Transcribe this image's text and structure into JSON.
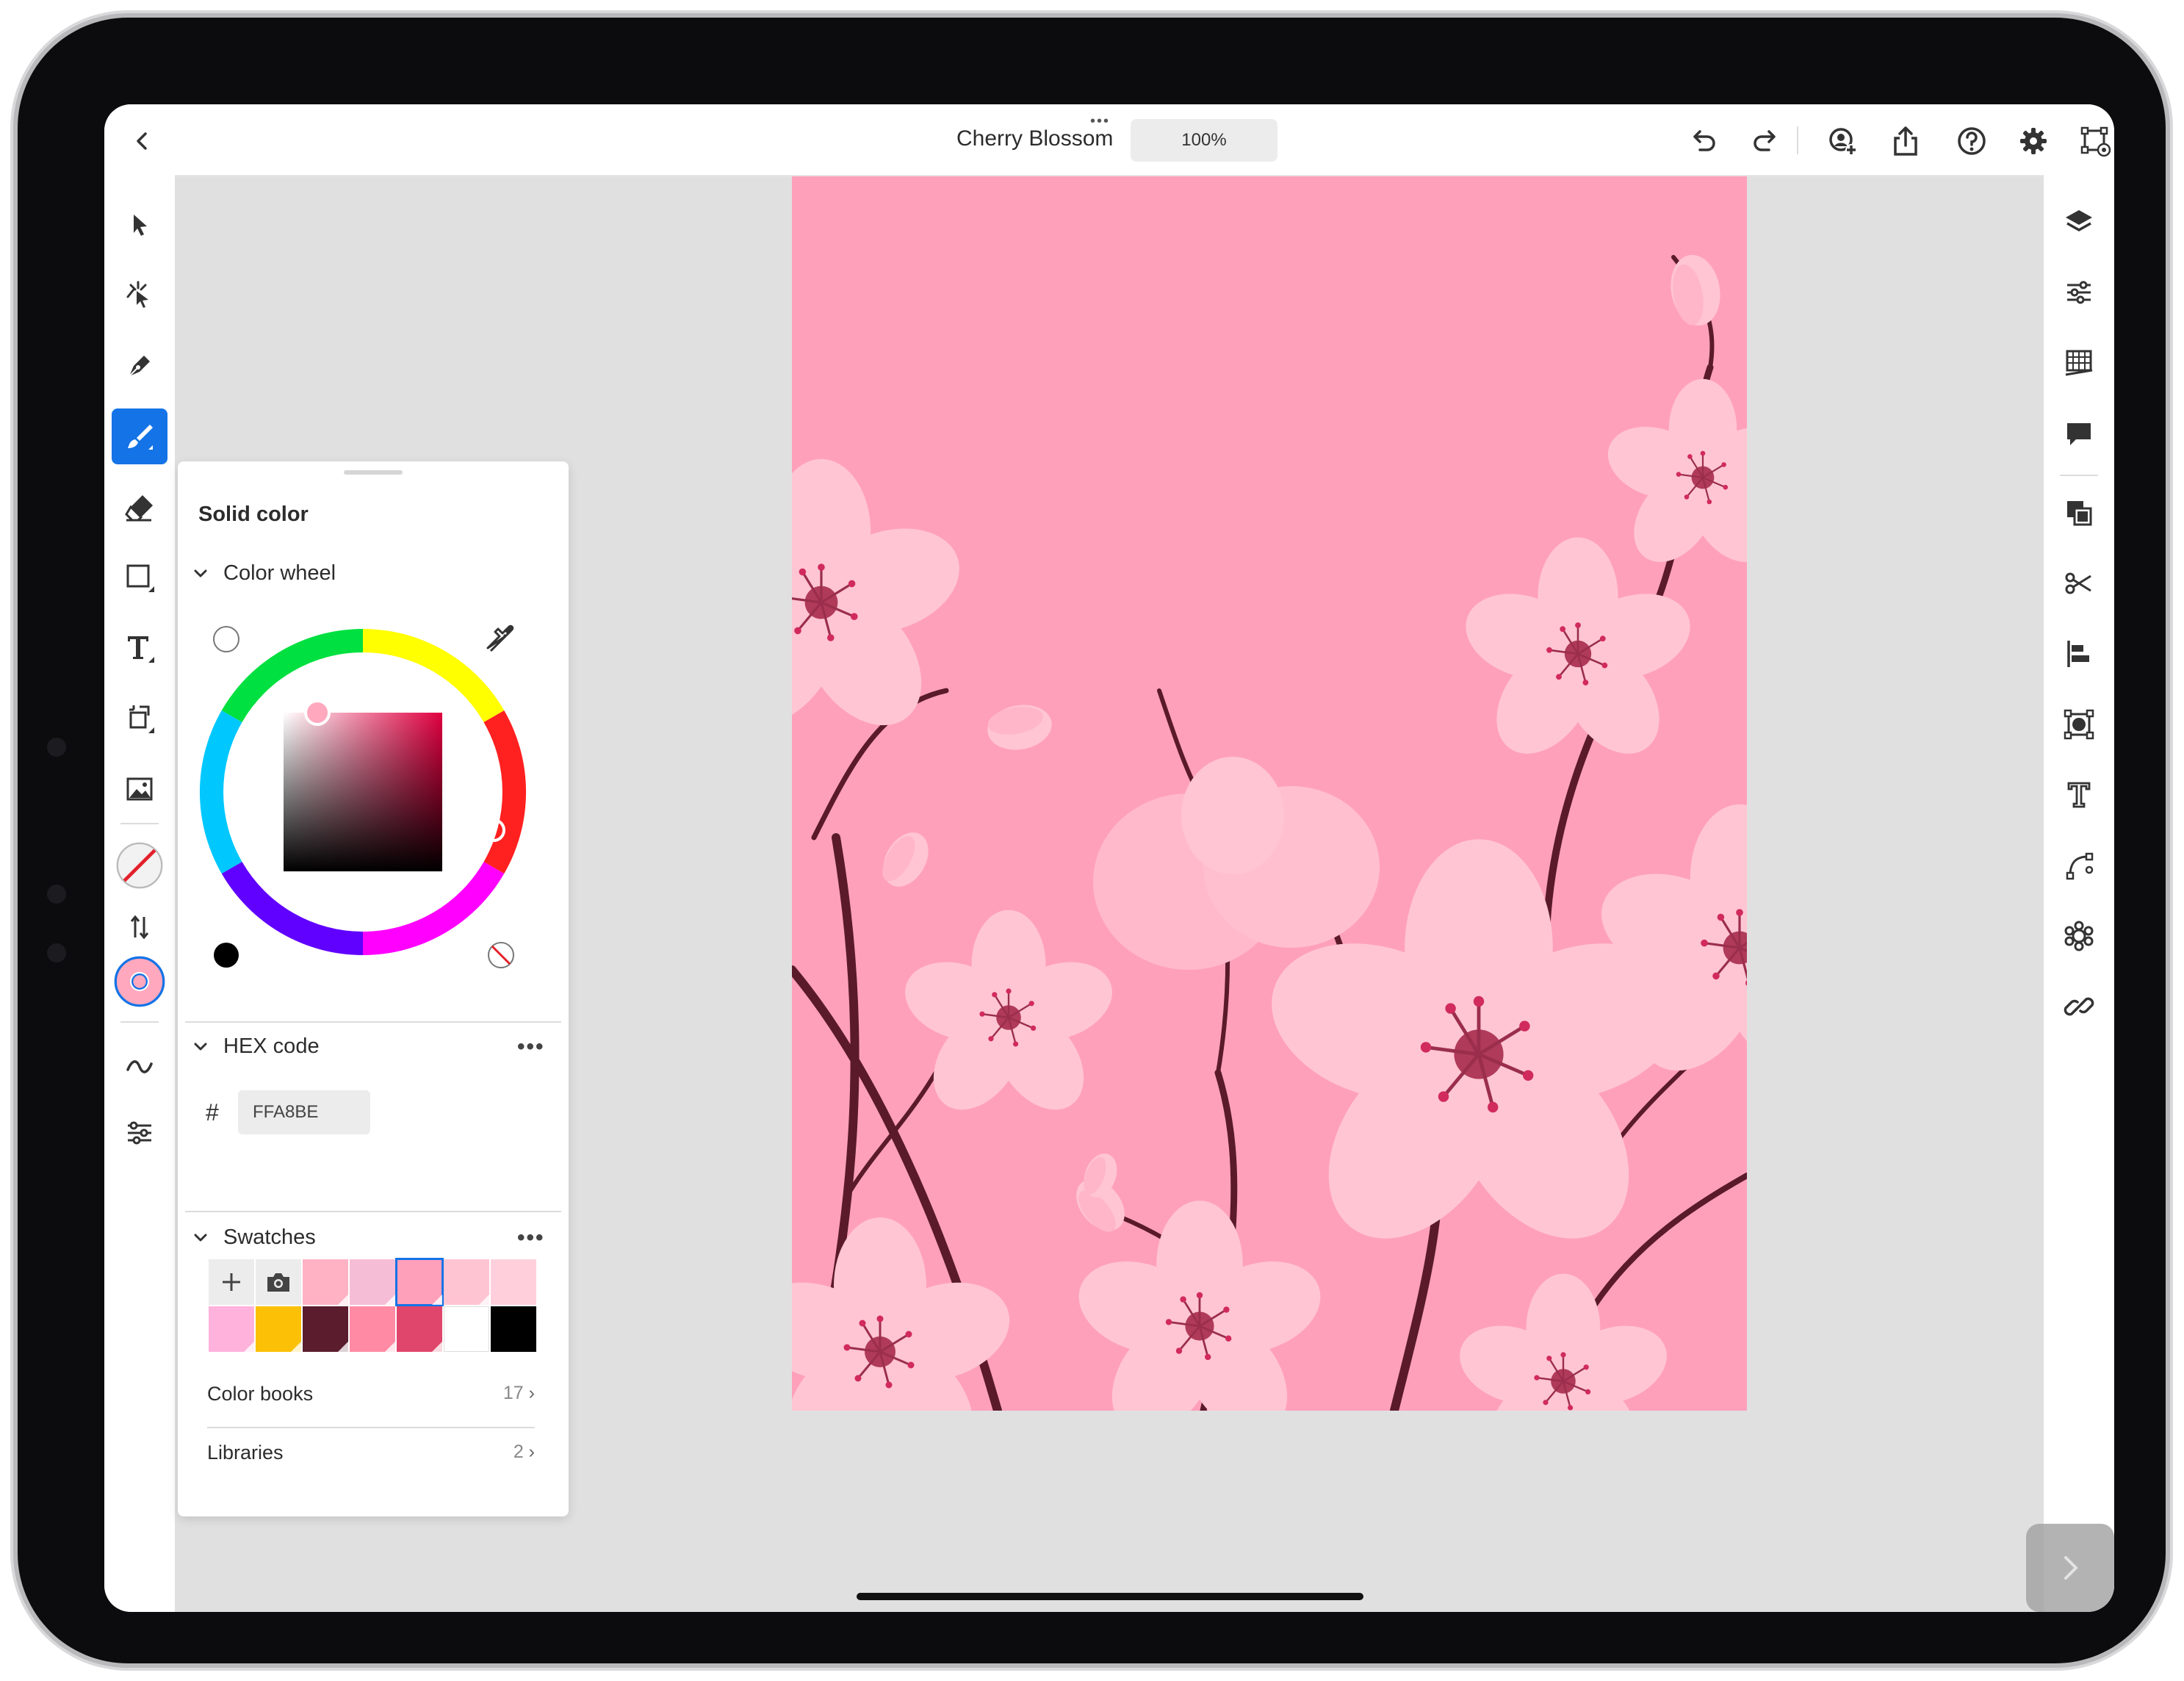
{
  "app": {
    "document_title": "Cherry Blossom",
    "zoom": "100%"
  },
  "toolbar": {
    "icons": [
      "back-icon",
      "undo-icon",
      "redo-icon",
      "invite-icon",
      "share-icon",
      "help-icon",
      "settings-icon",
      "view-icon"
    ]
  },
  "left_tools": [
    "select",
    "direct-select",
    "pen",
    "brush",
    "eraser",
    "shape",
    "text",
    "transform",
    "image",
    "fill-stroke",
    "swap",
    "color",
    "smooth",
    "brush-settings"
  ],
  "right_tools": [
    "layers",
    "properties",
    "grid",
    "comments",
    "arrange",
    "scissors",
    "align",
    "mask",
    "type",
    "path",
    "pattern",
    "link"
  ],
  "panel": {
    "title": "Solid color",
    "color_wheel": {
      "label": "Color wheel",
      "current_hex": "#FFA8BE"
    },
    "hex": {
      "label": "HEX code",
      "hash": "#",
      "value": "FFA8BE"
    },
    "swatches": {
      "label": "Swatches",
      "colors": [
        "#ffb2c4",
        "#f6bdd6",
        "#ffa0bb",
        "#ffc4d2",
        "#ffd0dc",
        "#ffb2dc",
        "#fcc006",
        "#5b1d2d",
        "#ff8aa4",
        "#e0456c",
        "#ffffff",
        "#000000"
      ]
    },
    "color_books": {
      "label": "Color books",
      "count": "17"
    },
    "libraries": {
      "label": "Libraries",
      "count": "2"
    }
  },
  "canvas": {
    "background": "#ffa0bb",
    "petal": "#ffc5d3",
    "branch": "#5a1a2a"
  }
}
